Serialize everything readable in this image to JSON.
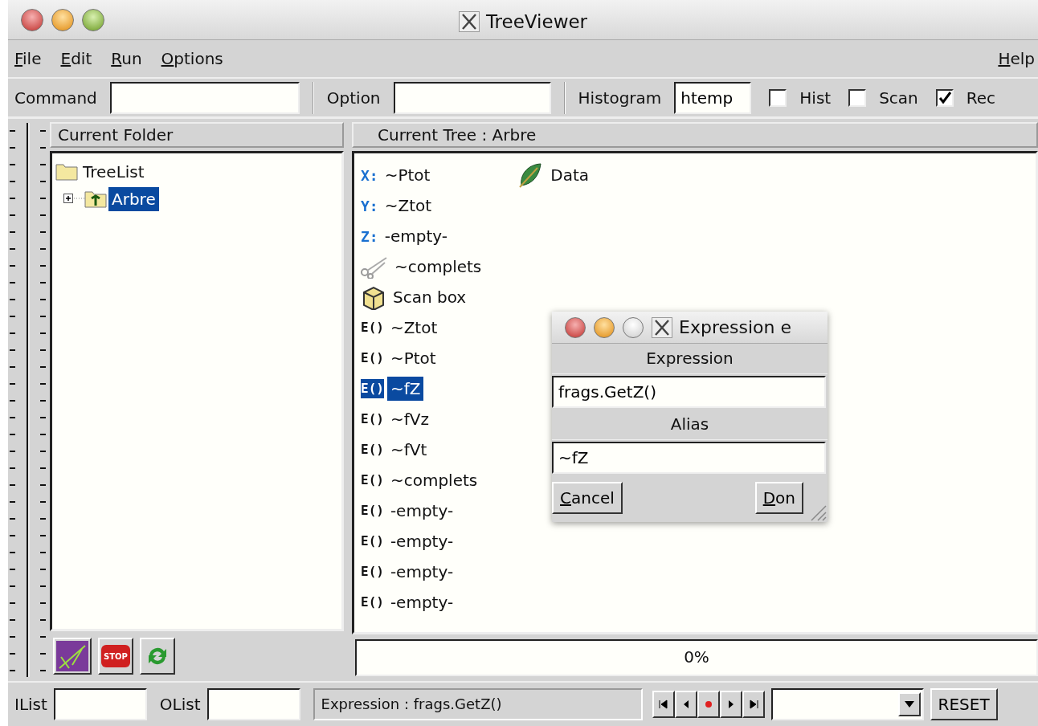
{
  "window": {
    "title": "TreeViewer"
  },
  "menu": [
    {
      "label": "File"
    },
    {
      "label": "Edit"
    },
    {
      "label": "Run"
    },
    {
      "label": "Options"
    }
  ],
  "menu_right": {
    "label": "Help"
  },
  "toolbar": {
    "command_label": "Command",
    "option_label": "Option",
    "histogram_label": "Histogram",
    "histogram_value": "htemp",
    "checks": [
      {
        "label": "Hist",
        "checked": false
      },
      {
        "label": "Scan",
        "checked": false
      },
      {
        "label": "Rec",
        "checked": true
      }
    ]
  },
  "folder_panel": {
    "title": "Current Folder",
    "tree": [
      {
        "label": "TreeList",
        "selected": false,
        "children": [
          {
            "label": "Arbre",
            "selected": true,
            "expanded": false
          }
        ]
      }
    ],
    "stop_label": "STOP"
  },
  "tree_panel": {
    "title": "Current Tree : Arbre",
    "data_item": "Data",
    "items": [
      {
        "kind": "axis",
        "marker": "X:",
        "label": "~Ptot",
        "selected": false
      },
      {
        "kind": "axis",
        "marker": "Y:",
        "label": "~Ztot",
        "selected": false
      },
      {
        "kind": "axis",
        "marker": "Z:",
        "label": "-empty-",
        "selected": false
      },
      {
        "kind": "cut",
        "label": "~complets",
        "selected": false
      },
      {
        "kind": "scan",
        "label": "Scan box",
        "selected": false
      },
      {
        "kind": "expr",
        "marker": "E()",
        "label": "~Ztot",
        "selected": false
      },
      {
        "kind": "expr",
        "marker": "E()",
        "label": "~Ptot",
        "selected": false
      },
      {
        "kind": "expr",
        "marker": "E()",
        "label": "~fZ",
        "selected": true
      },
      {
        "kind": "expr",
        "marker": "E()",
        "label": "~fVz",
        "selected": false
      },
      {
        "kind": "expr",
        "marker": "E()",
        "label": "~fVt",
        "selected": false
      },
      {
        "kind": "expr",
        "marker": "E()",
        "label": "~complets",
        "selected": false
      },
      {
        "kind": "expr",
        "marker": "E()",
        "label": "-empty-",
        "selected": false
      },
      {
        "kind": "expr",
        "marker": "E()",
        "label": "-empty-",
        "selected": false
      },
      {
        "kind": "expr",
        "marker": "E()",
        "label": "-empty-",
        "selected": false
      },
      {
        "kind": "expr",
        "marker": "E()",
        "label": "-empty-",
        "selected": false
      }
    ],
    "progress": {
      "text": "0%"
    }
  },
  "dialog": {
    "title": "Expression e",
    "expression_label": "Expression",
    "expression_value": "frags.GetZ()",
    "alias_label": "Alias",
    "alias_value": "~fZ",
    "cancel": "Cancel",
    "done": "Don"
  },
  "status_bar": {
    "ilist_label": "IList",
    "olist_label": "OList",
    "message": "Expression : frags.GetZ()",
    "reset": "RESET"
  }
}
